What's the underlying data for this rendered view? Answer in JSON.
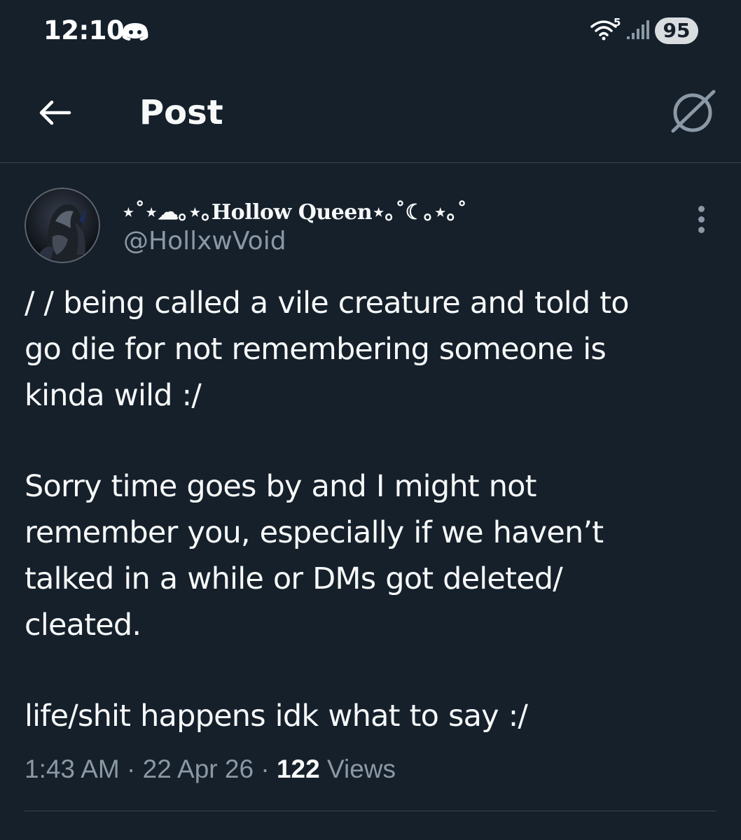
{
  "status_bar": {
    "time": "12:10",
    "wifi_label": "5",
    "battery": "95",
    "icons": [
      "discord-icon",
      "wifi-icon",
      "signal-icon"
    ]
  },
  "header": {
    "title": "Post",
    "back_icon": "arrow-left-icon",
    "right_icon": "grok-icon"
  },
  "post": {
    "display_name": "⋆˚⋆☁︎｡⋆｡Hollow Queen⋆｡˚☾｡⋆｡˚",
    "handle": "@HollxwVoid",
    "text_lines": [
      "/ / being called a vile creature and told to",
      "go die for not remembering someone is",
      "kinda wild :/",
      "Sorry time goes by and I might not",
      "remember you, especially if we haven’t",
      "talked in a while or DMs got deleted/",
      "cleated.",
      "life/shit happens idk what to say :/"
    ],
    "time": "1:43 AM",
    "date": "22 Apr 26",
    "separator": "·",
    "views_count": "122",
    "views_label": "Views"
  },
  "colors": {
    "background": "#15202b",
    "text_primary": "#f7f9f9",
    "text_secondary": "#8b98a5",
    "divider": "#38444d"
  }
}
